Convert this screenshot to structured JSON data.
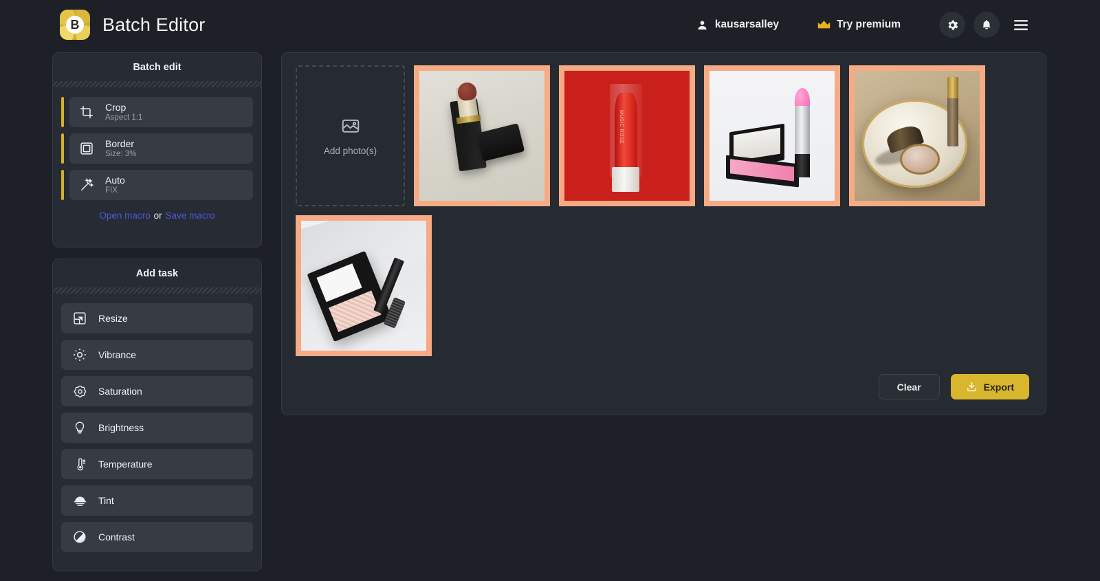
{
  "header": {
    "app_title": "Batch Editor",
    "logo_letter": "B",
    "username": "kausarsalley",
    "premium_label": "Try premium",
    "icons": [
      "user-icon",
      "crown-icon",
      "gear-icon",
      "bell-icon",
      "hamburger-menu-icon"
    ]
  },
  "batch_edit": {
    "title": "Batch edit",
    "accent_color": "#d3b02b",
    "rows": [
      {
        "icon": "crop-icon",
        "title": "Crop",
        "sub": "Aspect 1:1"
      },
      {
        "icon": "border-icon",
        "title": "Border",
        "sub": "Size: 3%"
      },
      {
        "icon": "magic-wand-icon",
        "title": "Auto",
        "sub": "FIX"
      }
    ],
    "open_macro": "Open macro",
    "or": "or",
    "save_macro": "Save macro",
    "link_color": "#5157dd"
  },
  "add_task": {
    "title": "Add task",
    "items": [
      {
        "icon": "resize-icon",
        "label": "Resize"
      },
      {
        "icon": "vibrance-icon",
        "label": "Vibrance"
      },
      {
        "icon": "saturation-icon",
        "label": "Saturation"
      },
      {
        "icon": "brightness-icon",
        "label": "Brightness"
      },
      {
        "icon": "temperature-icon",
        "label": "Temperature"
      },
      {
        "icon": "tint-icon",
        "label": "Tint"
      },
      {
        "icon": "contrast-icon",
        "label": "Contrast"
      }
    ]
  },
  "workspace": {
    "dropzone": {
      "icon": "image-placeholder-icon",
      "label": "Add photo(s)"
    },
    "photo_border_color": "#f6ab85",
    "photos": [
      {
        "alt": "dark-red-lipstick-on-cream-cloth"
      },
      {
        "alt": "red-lipstick-music-rose-on-red-background",
        "overlay_text": "MUSIC ROSE"
      },
      {
        "alt": "pink-lipstick-with-blush-compact-on-white"
      },
      {
        "alt": "gold-tray-with-compact-powder-and-lip-tube"
      },
      {
        "alt": "highlighter-compact-and-mascara-on-marble"
      }
    ],
    "clear_label": "Clear",
    "export_label": "Export",
    "export_icon": "download-icon",
    "export_color": "#d8b62e"
  }
}
